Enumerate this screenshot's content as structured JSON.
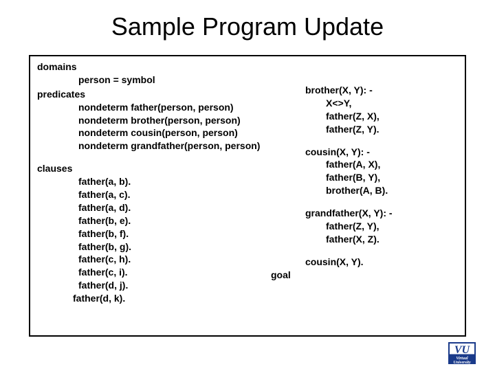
{
  "title": "Sample Program Update",
  "sections": {
    "domains": "domains",
    "domains_line": "person = symbol",
    "predicates": "predicates",
    "pred_lines": [
      "nondeterm father(person, person)",
      "nondeterm brother(person, person)",
      "nondeterm cousin(person, person)",
      "nondeterm grandfather(person, person)"
    ],
    "clauses": "clauses",
    "clause_lines": [
      "father(a, b).",
      "father(a, c).",
      "father(a, d).",
      "father(b, e).",
      "father(b, f).",
      "father(b, g).",
      "father(c, h).",
      "father(c, i).",
      "father(d, j).",
      "father(d, k)."
    ],
    "brother_head": "brother(X, Y): -",
    "brother_body": [
      "X<>Y,",
      "father(Z, X),",
      "father(Z, Y)."
    ],
    "cousin_head": "cousin(X, Y): -",
    "cousin_body": [
      "father(A, X),",
      "father(B, Y),",
      "brother(A, B)."
    ],
    "grand_head": "grandfather(X, Y): -",
    "grand_body": [
      "father(Z, Y),",
      "father(X, Z)."
    ],
    "goal_label": "goal",
    "goal_line": "cousin(X, Y)."
  },
  "logo": {
    "text": "VU",
    "sub": "Virtual University"
  }
}
